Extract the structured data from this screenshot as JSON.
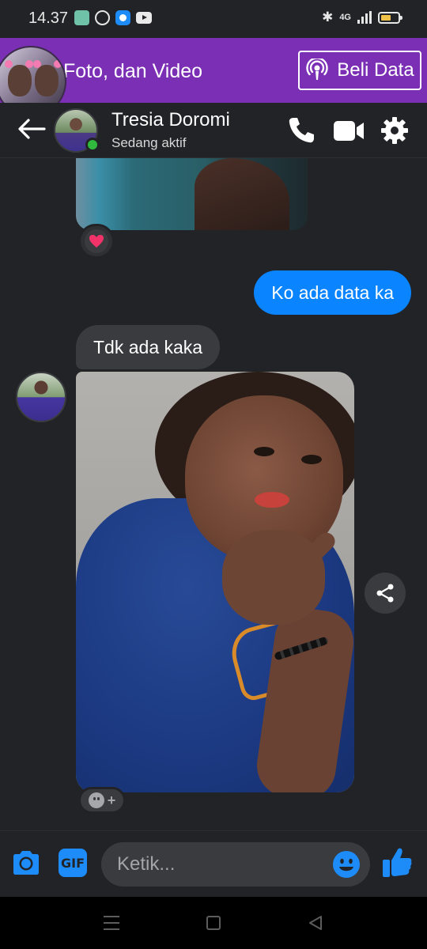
{
  "status_bar": {
    "time": "14.37",
    "network": "4G",
    "icons": [
      "app-green-icon",
      "sync-icon",
      "browser-icon",
      "youtube-icon",
      "bluetooth-icon",
      "signal-icon",
      "battery-icon"
    ]
  },
  "banner": {
    "text": "Foto, dan Video",
    "button_label": "Beli Data",
    "button_icon": "podcast-icon",
    "background": "#7b2fb5"
  },
  "header": {
    "contact_name": "Tresia Doromi",
    "contact_status": "Sedang aktif",
    "icons": [
      "back-arrow-icon",
      "phone-icon",
      "video-camera-icon",
      "gear-icon"
    ]
  },
  "messages": [
    {
      "type": "image",
      "direction": "incoming",
      "reaction": "heart"
    },
    {
      "type": "text",
      "direction": "outgoing",
      "text": "Ko ada data ka"
    },
    {
      "type": "text",
      "direction": "incoming",
      "text": "Tdk ada kaka"
    },
    {
      "type": "image",
      "direction": "incoming",
      "reaction": "add-reaction"
    }
  ],
  "composer": {
    "placeholder": "Ketik...",
    "icons": [
      "camera-icon",
      "gif-icon",
      "emoji-icon",
      "thumbs-up-icon"
    ],
    "gif_label": "GIF"
  },
  "colors": {
    "accent": "#0a84ff",
    "background": "#222326",
    "incoming_bubble": "#3a3b3e",
    "online": "#31b93e"
  }
}
